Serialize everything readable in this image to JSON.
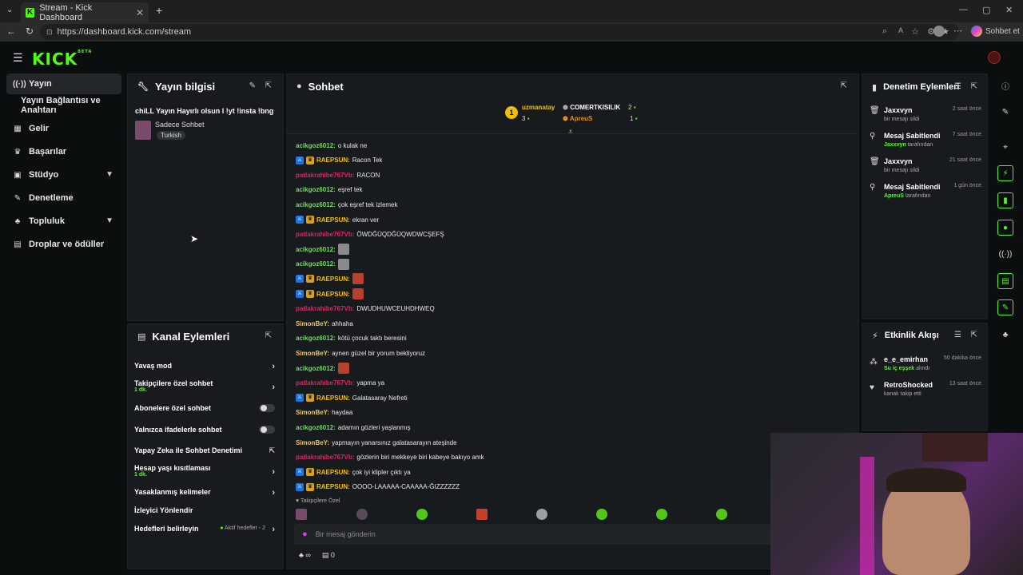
{
  "browser": {
    "tab_title": "Stream - Kick Dashboard",
    "url": "https://dashboard.kick.com/stream",
    "chat_button": "Sohbet et"
  },
  "logo": {
    "text": "KICK",
    "beta": "BETA"
  },
  "nav": {
    "items": [
      {
        "label": "Yayın"
      },
      {
        "label": "Yayın Bağlantısı ve Anahtarı"
      },
      {
        "label": "Gelir"
      },
      {
        "label": "Başarılar"
      },
      {
        "label": "Stüdyo"
      },
      {
        "label": "Denetleme"
      },
      {
        "label": "Topluluk"
      },
      {
        "label": "Droplar ve ödüller"
      }
    ]
  },
  "stream_info": {
    "title": "Yayın bilgisi",
    "stream_title": "chiLL Yayın Hayırlı olsun l !yt !insta !bng",
    "category": "Sadece Sohbet",
    "tag": "Turkish"
  },
  "channel_actions": {
    "title": "Kanal Eylemleri",
    "items": [
      {
        "label": "Yavaş mod"
      },
      {
        "label": "Takipçilere özel sohbet",
        "sub": "1 dk."
      },
      {
        "label": "Abonelere özel sohbet"
      },
      {
        "label": "Yalnızca ifadelerle sohbet"
      },
      {
        "label": "Yapay Zeka ile Sohbet Denetimi"
      },
      {
        "label": "Hesap yaşı kısıtlaması",
        "sub": "1 dk."
      },
      {
        "label": "Yasaklanmış kelimeler"
      },
      {
        "label": "İzleyici Yönlendir"
      },
      {
        "label": "Hedefleri belirleyin",
        "extra": "Aktif hedefler - 2"
      }
    ]
  },
  "chat": {
    "title": "Sohbet",
    "leaderboard": [
      {
        "rank": "1",
        "name": "uzmanatay",
        "count": "3"
      },
      {
        "name": "COMERTKISILIK",
        "count": "2"
      },
      {
        "name": "ApreuS",
        "count": "1"
      }
    ],
    "messages": [
      {
        "user": "acikgoz6012",
        "text": "o kulak ne",
        "color": "#7bd66b"
      },
      {
        "user": "RAEPSUN",
        "text": "Racon Tek",
        "color": "#f0c000",
        "badges": true
      },
      {
        "user": "patlakrahibe767Vb",
        "text": "RACON",
        "color": "#e0245e"
      },
      {
        "user": "acikgoz6012",
        "text": "eşref tek",
        "color": "#7bd66b"
      },
      {
        "user": "acikgoz6012",
        "text": "çok eşref tek izlemek",
        "color": "#7bd66b"
      },
      {
        "user": "RAEPSUN",
        "text": "ekran ver",
        "color": "#f0c000",
        "badges": true
      },
      {
        "user": "patlakrahibe767Vb",
        "text": "ÖWDĞÜQDĞÜQWDWCŞEFŞ",
        "color": "#e0245e"
      },
      {
        "user": "acikgoz6012",
        "text": "",
        "color": "#7bd66b",
        "emote": "#8a8a8a"
      },
      {
        "user": "acikgoz6012",
        "text": "",
        "color": "#7bd66b",
        "emote": "#8a8a8a"
      },
      {
        "user": "RAEPSUN",
        "text": "",
        "color": "#f0c000",
        "badges": true,
        "emote": "#b5412e"
      },
      {
        "user": "RAEPSUN",
        "text": "",
        "color": "#f0c000",
        "badges": true,
        "emote": "#b5412e"
      },
      {
        "user": "patlakrahibe767Vb",
        "text": "DWUDHUWCEUHDHWEQ",
        "color": "#e0245e"
      },
      {
        "user": "SimonBeY",
        "text": "ahhaha",
        "color": "#e8c468"
      },
      {
        "user": "acikgoz6012",
        "text": "kötü çocuk taktı beresini",
        "color": "#7bd66b"
      },
      {
        "user": "SimonBeY",
        "text": "aynen güzel bir yorum bekliyoruz",
        "color": "#e8c468"
      },
      {
        "user": "acikgoz6012",
        "text": "",
        "color": "#7bd66b",
        "emote": "#b5412e"
      },
      {
        "user": "patlakrahibe767Vb",
        "text": "yapma ya",
        "color": "#e0245e"
      },
      {
        "user": "RAEPSUN",
        "text": "Galatasaray Nefreti",
        "color": "#f0c000",
        "badges": true
      },
      {
        "user": "SimonBeY",
        "text": "haydaa",
        "color": "#e8c468"
      },
      {
        "user": "acikgoz6012",
        "text": "adamın gözleri yaşlanmış",
        "color": "#7bd66b"
      },
      {
        "user": "SimonBeY",
        "text": "yapmayın yanarsınız galatasarayın ateşinde",
        "color": "#e8c468"
      },
      {
        "user": "patlakrahibe767Vb",
        "text": "gözlerin biri mekkeye biri kabeye bakıyo amk",
        "color": "#e0245e"
      },
      {
        "user": "RAEPSUN",
        "text": "çok iyi klipler çıktı ya",
        "color": "#f0c000",
        "badges": true
      },
      {
        "user": "RAEPSUN",
        "text": "OOOO-LAAAAA-CAAAAA-ĞIZZZZZZ",
        "color": "#f0c000",
        "badges": true
      }
    ],
    "followers_only_label": "Takipçilere Özel",
    "input_placeholder": "Bir mesaj gönderin",
    "viewers": "∞",
    "count": "0"
  },
  "moderation": {
    "title": "Denetim Eylemleri",
    "items": [
      {
        "title": "Jaxxvyn",
        "sub": "bir mesajı sildi",
        "time": "2 saat önce"
      },
      {
        "title": "Mesaj Sabitlendi",
        "sub_user": "Jaxxvyn",
        "sub": "tarafından",
        "time": "7 saat önce"
      },
      {
        "title": "Jaxxvyn",
        "sub": "bir mesajı sildi",
        "time": "21 saat önce"
      },
      {
        "title": "Mesaj Sabitlendi",
        "sub_user": "ApreuS",
        "sub": "tarafından",
        "time": "1 gün önce"
      }
    ]
  },
  "activity": {
    "title": "Etkinlik Akışı",
    "items": [
      {
        "title": "e_e_emirhan",
        "sub_user": "Su iç eşşek",
        "sub": "alındı",
        "time": "50 dakika önce"
      },
      {
        "title": "RetroShocked",
        "sub": "kanalı takip etti",
        "time": "13 saat önce"
      }
    ]
  },
  "colors": {
    "accent": "#53fc18",
    "panel": "#181b1d",
    "bg": "#0b0e0f"
  }
}
